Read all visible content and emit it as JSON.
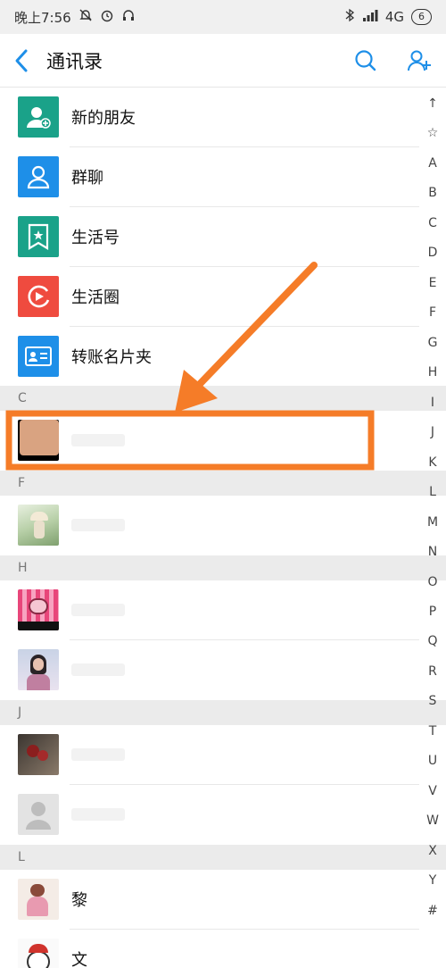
{
  "status_bar": {
    "time": "晚上7:56",
    "network": "4G",
    "battery": "6"
  },
  "header": {
    "title": "通讯录"
  },
  "function_items": [
    {
      "label": "新的朋友",
      "icon": "new-friend-icon",
      "color": "#1aa289"
    },
    {
      "label": "群聊",
      "icon": "group-chat-icon",
      "color": "#1e8fe8"
    },
    {
      "label": "生活号",
      "icon": "life-account-icon",
      "color": "#1aa289"
    },
    {
      "label": "生活圈",
      "icon": "life-circle-icon",
      "color": "#ef4b3f"
    },
    {
      "label": "转账名片夹",
      "icon": "card-folder-icon",
      "color": "#1e8fe8"
    }
  ],
  "sections": {
    "c": "C",
    "f": "F",
    "h": "H",
    "j": "J",
    "l": "L"
  },
  "contacts": {
    "l1_name": "黎",
    "l2_name": "文"
  },
  "index_letters": [
    "↑",
    "☆",
    "A",
    "B",
    "C",
    "D",
    "E",
    "F",
    "G",
    "H",
    "I",
    "J",
    "K",
    "L",
    "M",
    "N",
    "O",
    "P",
    "Q",
    "R",
    "S",
    "T",
    "U",
    "V",
    "W",
    "X",
    "Y",
    "#"
  ],
  "colors": {
    "accent_blue": "#1e8fe8",
    "annotation_orange": "#f57c28"
  }
}
